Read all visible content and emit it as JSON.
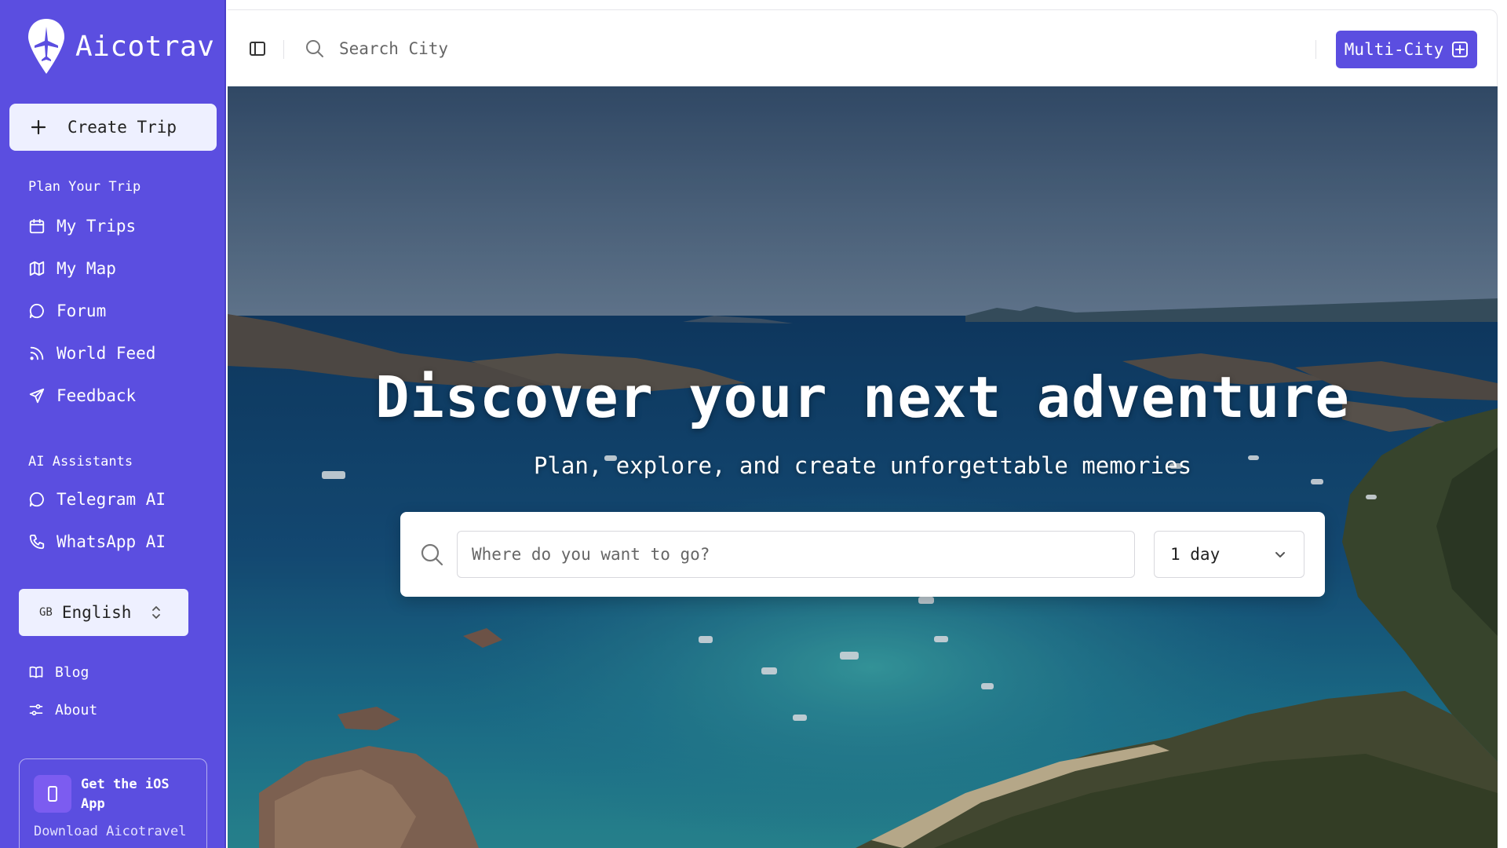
{
  "brand": {
    "name": "Aicotrav",
    "logo_icon": "airplane-pin-icon"
  },
  "sidebar": {
    "create_trip_label": "Create Trip",
    "plan_section_label": "Plan Your Trip",
    "plan_items": [
      {
        "label": "My Trips",
        "icon": "calendar-icon"
      },
      {
        "label": "My Map",
        "icon": "map-icon"
      },
      {
        "label": "Forum",
        "icon": "chat-bubble-icon"
      },
      {
        "label": "World Feed",
        "icon": "rss-icon"
      },
      {
        "label": "Feedback",
        "icon": "send-icon"
      }
    ],
    "ai_section_label": "AI Assistants",
    "ai_items": [
      {
        "label": "Telegram AI",
        "icon": "chat-bubble-icon"
      },
      {
        "label": "WhatsApp AI",
        "icon": "phone-icon"
      }
    ],
    "language": {
      "flag_code": "GB",
      "selected": "English"
    },
    "footer_items": [
      {
        "label": "Blog",
        "icon": "book-icon"
      },
      {
        "label": "About",
        "icon": "sliders-icon"
      }
    ],
    "ios_card": {
      "title": "Get the iOS App",
      "subtitle": "Download Aicotravel"
    }
  },
  "topbar": {
    "search_placeholder": "Search City",
    "multi_city_label": "Multi-City"
  },
  "hero": {
    "title": "Discover your next adventure",
    "subtitle": "Plan, explore, and create unforgettable memories",
    "destination_placeholder": "Where do you want to go?",
    "duration_selected": "1 day"
  },
  "colors": {
    "brand": "#5b4ee0",
    "light_button": "#eef0ff",
    "sea": "#1d6f8c"
  }
}
